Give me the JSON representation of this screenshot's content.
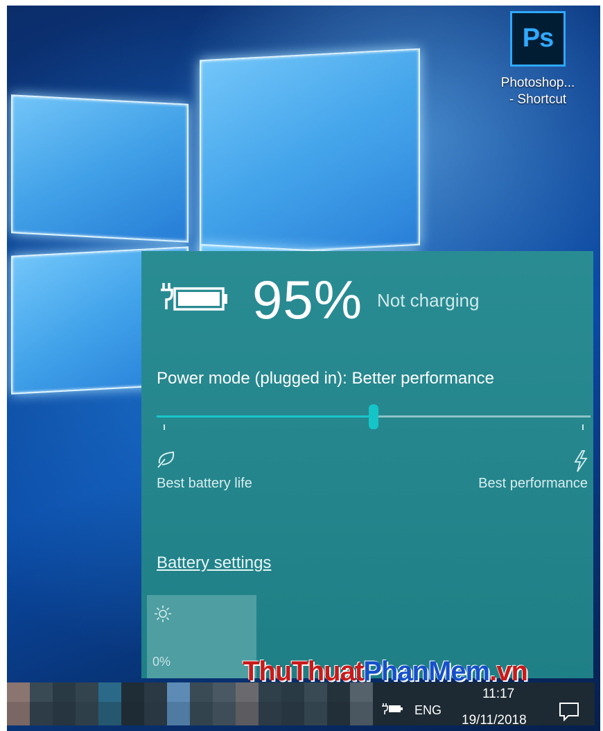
{
  "desktop": {
    "shortcut": {
      "icon_text": "Ps",
      "label_line1": "Photoshop...",
      "label_line2": "- Shortcut"
    }
  },
  "battery": {
    "percent": "95%",
    "status": "Not charging",
    "power_mode_label": "Power mode (plugged in): Better performance",
    "slider_value": 0.5,
    "left_label": "Best battery life",
    "right_label": "Best performance",
    "settings_link": "Battery settings",
    "brightness_value": "0%"
  },
  "watermark": {
    "part1": "ThuThuat",
    "part2": "PhanMem",
    "part3": ".vn"
  },
  "taskbar": {
    "language": "ENG",
    "time": "11:17",
    "date": "19/11/2018"
  },
  "colors": {
    "flyout": "#2a8c93",
    "slider_accent": "#15c4c7",
    "taskbar": "#1d2a33"
  }
}
